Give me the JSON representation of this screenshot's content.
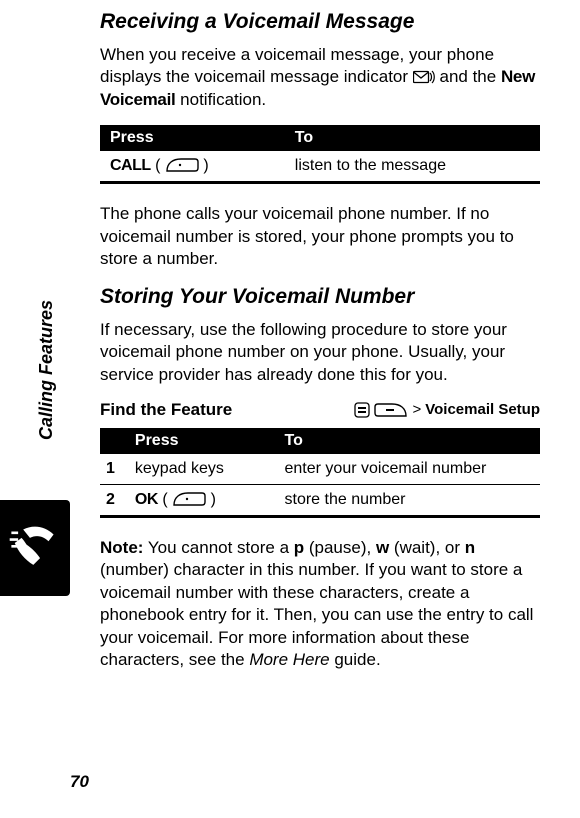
{
  "side_label": "Calling Features",
  "page_number": "70",
  "section1": {
    "heading": "Receiving a Voicemail Message",
    "para1_a": "When you receive a voicemail message, your phone displays the voicemail message indicator ",
    "para1_b": " and the ",
    "notif_label": "New Voicemail",
    "para1_c": " notification.",
    "table": {
      "header_press": "Press",
      "header_to": "To",
      "row1_press_label": "CALL",
      "row1_to": "listen to the message"
    },
    "para2": "The phone calls your voicemail phone number. If no voicemail number is stored, your phone prompts you to store a number."
  },
  "section2": {
    "heading": "Storing Your Voicemail Number",
    "para1": "If necessary, use the following procedure to store your voicemail phone number on your phone. Usually, your service provider has already done this for you.",
    "feature_label": "Find the Feature",
    "breadcrumb_tail": "Voicemail Setup",
    "gt": ">",
    "table": {
      "header_press": "Press",
      "header_to": "To",
      "row1_num": "1",
      "row1_press": "keypad keys",
      "row1_to": "enter your voicemail number",
      "row2_num": "2",
      "row2_press_label": "OK",
      "row2_to": "store the number"
    },
    "note_label": "Note:",
    "note_a": " You cannot store a ",
    "ch_p": "p",
    "note_b": " (pause), ",
    "ch_w": "w",
    "note_c": " (wait), or ",
    "ch_n": "n",
    "note_d": " (number) character in this number. If you want to store a voicemail number with these characters, create a phonebook entry for it. Then, you can use the entry to call your voicemail. For more information about these characters, see the ",
    "more_here": "More Here",
    "note_e": " guide."
  }
}
